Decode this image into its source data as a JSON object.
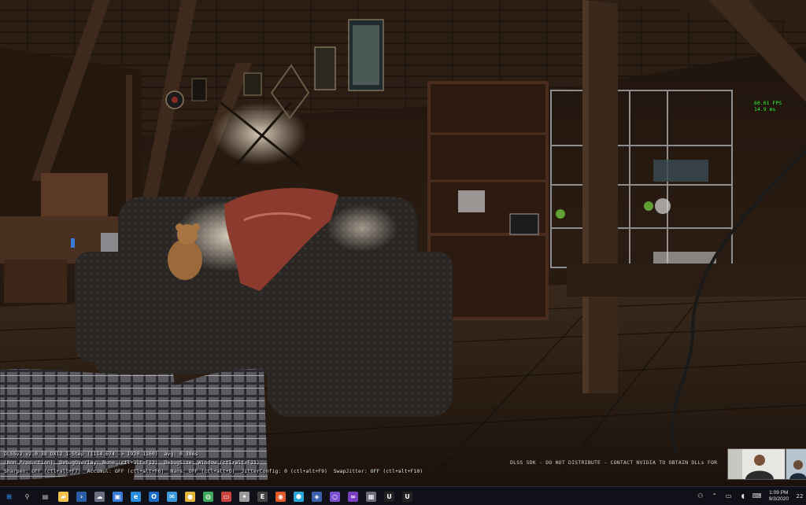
{
  "overlay": {
    "fps_line": "60.01 FPS",
    "ms_line": "14.9 ms",
    "debug_lines": [
      "DLSSv2 v2.0.38 DX12 1-Step (1114.674 -> 1920.1160)  avg: 0.38ms",
      "(Non Production)  DebugOverlay: None (ctl+alt+F12)  DebugSize: Window (ctl+alt+F11)",
      "Sharpen: OFF (ctl+alt+F7)  Accumul: OFF (ctl+alt+F6)  Nans: OFF (ctl+alt+O)  JitterConfig: 0 (ctl+alt+F9)  SwapJitter: OFF (ctl+alt+F10)"
    ],
    "sdk_notice": "DLSS SDK - DO NOT DISTRIBUTE - CONTACT NVIDIA TO OBTAIN DLLs FOR"
  },
  "taskbar": {
    "apps": [
      {
        "name": "start-button",
        "icon": "windows-logo-icon",
        "glyph": "⊞",
        "color": "#2f8fff"
      },
      {
        "name": "search-button",
        "icon": "search-icon",
        "glyph": "⚲",
        "color": "#cfcfcf"
      },
      {
        "name": "task-view-button",
        "icon": "task-view-icon",
        "glyph": "▤",
        "color": "#cfcfcf"
      },
      {
        "name": "file-explorer-app",
        "icon": "folder-icon",
        "glyph": "▰",
        "color": "#f2c14e"
      },
      {
        "name": "powershell-app",
        "icon": "terminal-icon",
        "glyph": "›",
        "color": "#2c5ea8"
      },
      {
        "name": "app-3",
        "icon": "cloud-icon",
        "glyph": "☁",
        "color": "#6d6d80"
      },
      {
        "name": "app-4",
        "icon": "window-icon",
        "glyph": "▣",
        "color": "#3b7bd8"
      },
      {
        "name": "edge-app",
        "icon": "edge-icon",
        "glyph": "e",
        "color": "#2a8ee0"
      },
      {
        "name": "outlook-app",
        "icon": "outlook-icon",
        "glyph": "O",
        "color": "#1c6bc4"
      },
      {
        "name": "app-7",
        "icon": "chat-icon",
        "glyph": "✉",
        "color": "#3a9ad9"
      },
      {
        "name": "chrome-app",
        "icon": "chrome-icon",
        "glyph": "●",
        "color": "#e2b53a"
      },
      {
        "name": "app-9",
        "icon": "globe-icon",
        "glyph": "◍",
        "color": "#3fa85f"
      },
      {
        "name": "app-10",
        "icon": "presentation-icon",
        "glyph": "▭",
        "color": "#c9433c"
      },
      {
        "name": "app-11",
        "icon": "gamepad-icon",
        "glyph": "✦",
        "color": "#9a9a9a"
      },
      {
        "name": "app-12",
        "icon": "epic-games-icon",
        "glyph": "E",
        "color": "#444"
      },
      {
        "name": "app-13",
        "icon": "browser-icon",
        "glyph": "◉",
        "color": "#e05a2a"
      },
      {
        "name": "app-14",
        "icon": "shield-icon",
        "glyph": "⬢",
        "color": "#2aa7d9"
      },
      {
        "name": "app-15",
        "icon": "steam-icon",
        "glyph": "◈",
        "color": "#3b5fa8"
      },
      {
        "name": "app-16",
        "icon": "ring-icon",
        "glyph": "○",
        "color": "#7a4fd0"
      },
      {
        "name": "visual-studio-app",
        "icon": "visual-studio-icon",
        "glyph": "∞",
        "color": "#7a3fc0"
      },
      {
        "name": "app-18",
        "icon": "monitor-icon",
        "glyph": "▦",
        "color": "#6c6c7a"
      },
      {
        "name": "unreal-app-1",
        "icon": "unreal-engine-icon",
        "glyph": "U",
        "color": "#222"
      },
      {
        "name": "unreal-app-2",
        "icon": "unreal-engine-icon",
        "glyph": "U",
        "color": "#222"
      }
    ],
    "tray": {
      "icons": [
        {
          "name": "people-icon",
          "glyph": "⚇"
        },
        {
          "name": "chevron-up-icon",
          "glyph": "⌃"
        },
        {
          "name": "network-icon",
          "glyph": "▭"
        },
        {
          "name": "speaker-icon",
          "glyph": "◖"
        },
        {
          "name": "keyboard-icon",
          "glyph": "⌨"
        }
      ],
      "time": "1:09 PM",
      "date": "9/3/2020",
      "notification_count": "22"
    }
  }
}
